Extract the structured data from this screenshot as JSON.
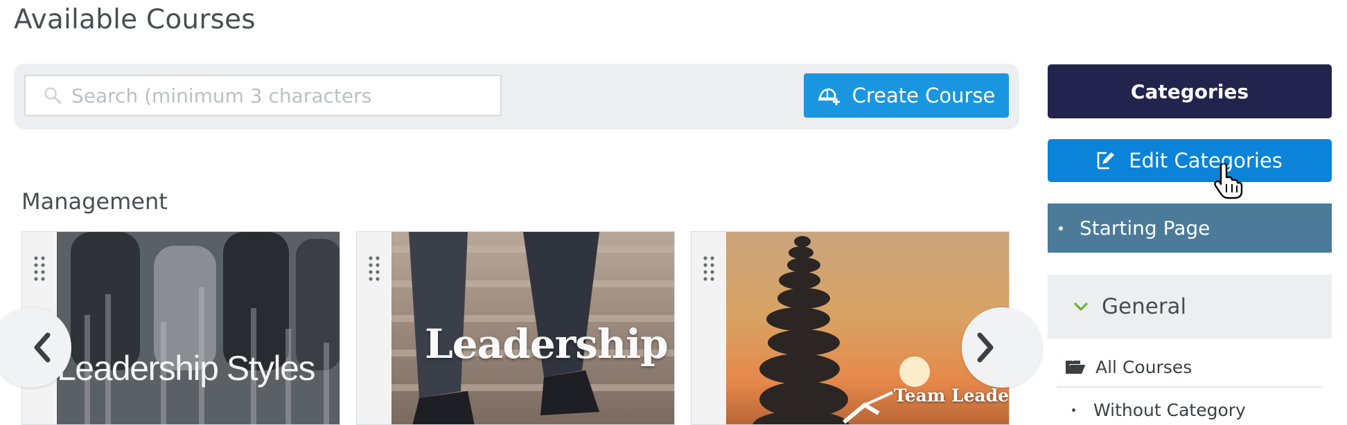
{
  "page": {
    "title": "Available Courses"
  },
  "search": {
    "placeholder": "Search (minimum 3 characters"
  },
  "toolbar": {
    "create_label": "Create Course"
  },
  "section": {
    "title": "Management"
  },
  "courses": [
    {
      "image_text": "Leadership Styles"
    },
    {
      "image_text": "Leadership"
    },
    {
      "image_text": "Team Leader"
    }
  ],
  "sidebar": {
    "header": "Categories",
    "edit_label": "Edit Categories",
    "starting_page": "Starting Page",
    "group": "General",
    "items": [
      "All Courses",
      "Without Category"
    ]
  },
  "colors": {
    "primary_button": "#1a96e0",
    "edit_button": "#0a83d8",
    "sidebar_header": "#23244e",
    "starting_page": "#4b7b98",
    "chevron": "#6ab42d"
  },
  "icons": {
    "search": "search-icon",
    "create": "create-course-icon",
    "edit": "edit-icon",
    "chevron": "chevron-down-icon",
    "folder": "folder-open-icon",
    "drag": "drag-handle-icon",
    "prev": "chevron-left-icon",
    "next": "chevron-right-icon",
    "cursor": "hand-pointer-icon"
  }
}
